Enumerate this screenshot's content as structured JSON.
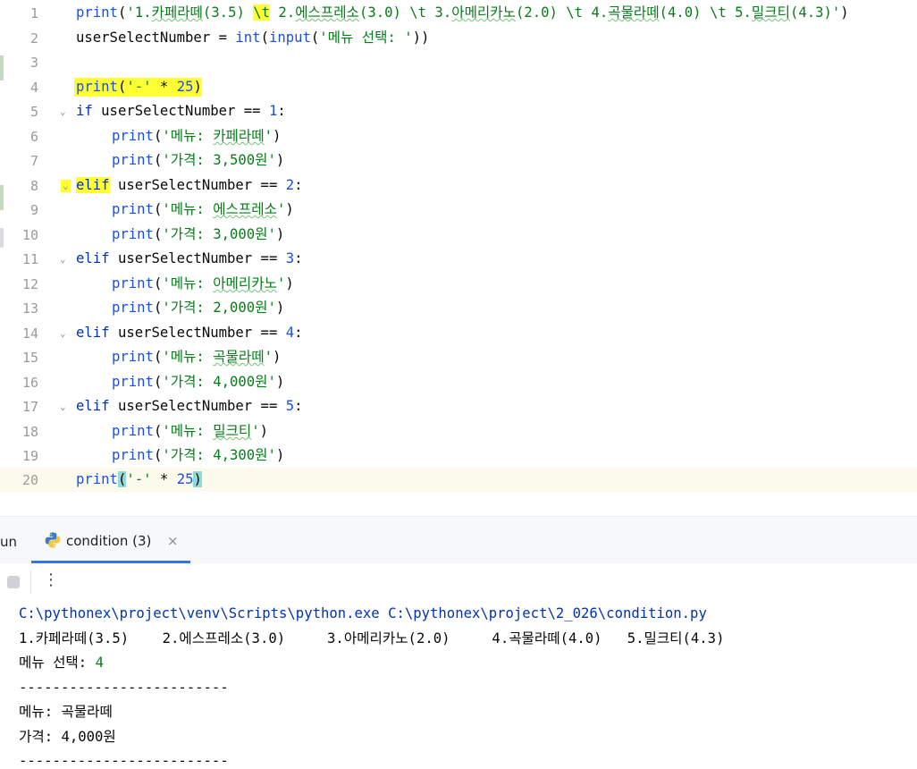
{
  "editor": {
    "line_numbers": [
      "1",
      "2",
      "3",
      "4",
      "5",
      "6",
      "7",
      "8",
      "9",
      "10",
      "11",
      "12",
      "13",
      "14",
      "15",
      "16",
      "17",
      "18",
      "19",
      "20"
    ],
    "lines": {
      "l1": {
        "print": "print",
        "open": "(",
        "s1": "'1.",
        "s2": "카페라떼",
        "s3": "(3.5) ",
        "esc1": "\\t",
        "s4": " 2.",
        "s5": "에스프레소",
        "s6": "(3.0) \\t 3.",
        "s7": "아메리카노",
        "s8": "(2.0) \\t 4.",
        "s9": "곡물라떼",
        "s10": "(4.0) \\t 5.",
        "s11": "밀크티",
        "s12": "(4.3)'",
        "close": ")"
      },
      "l2": {
        "var": "userSelectNumber = ",
        "int": "int",
        "open": "(",
        "input": "input",
        "open2": "(",
        "str": "'메뉴 선택: '",
        "close": "))"
      },
      "l4": {
        "print": "print",
        "open": "(",
        "str": "'-'",
        "rest": " * ",
        "num": "25",
        "close": ")"
      },
      "l5": {
        "kw": "if",
        "rest": " userSelectNumber == ",
        "num": "1",
        "colon": ":"
      },
      "l6": {
        "print": "print",
        "open": "(",
        "s1": "'메뉴: ",
        "s2": "카페라떼",
        "s3": "'",
        "close": ")"
      },
      "l7": {
        "print": "print",
        "open": "(",
        "str": "'가격: 3,500원'",
        "close": ")"
      },
      "l8": {
        "kw": "elif",
        "rest": " userSelectNumber == ",
        "num": "2",
        "colon": ":"
      },
      "l9": {
        "print": "print",
        "open": "(",
        "s1": "'메뉴: ",
        "s2": "에스프레소",
        "s3": "'",
        "close": ")"
      },
      "l10": {
        "print": "print",
        "open": "(",
        "str": "'가격: 3,000원'",
        "close": ")"
      },
      "l11": {
        "kw": "elif",
        "rest": " userSelectNumber == ",
        "num": "3",
        "colon": ":"
      },
      "l12": {
        "print": "print",
        "open": "(",
        "s1": "'메뉴: ",
        "s2": "아메리카노",
        "s3": "'",
        "close": ")"
      },
      "l13": {
        "print": "print",
        "open": "(",
        "str": "'가격: 2,000원'",
        "close": ")"
      },
      "l14": {
        "kw": "elif",
        "rest": " userSelectNumber == ",
        "num": "4",
        "colon": ":"
      },
      "l15": {
        "print": "print",
        "open": "(",
        "s1": "'메뉴: ",
        "s2": "곡물라떼",
        "s3": "'",
        "close": ")"
      },
      "l16": {
        "print": "print",
        "open": "(",
        "str": "'가격: 4,000원'",
        "close": ")"
      },
      "l17": {
        "kw": "elif",
        "rest": " userSelectNumber == ",
        "num": "5",
        "colon": ":"
      },
      "l18": {
        "print": "print",
        "open": "(",
        "s1": "'메뉴: ",
        "s2": "밀크티",
        "s3": "'",
        "close": ")"
      },
      "l19": {
        "print": "print",
        "open": "(",
        "str": "'가격: 4,300원'",
        "close": ")"
      },
      "l20": {
        "print": "print",
        "open": "(",
        "str": "'-'",
        "rest": " * ",
        "num": "25",
        "close": ")"
      }
    },
    "fold_marker": "⌄"
  },
  "run_panel": {
    "label": "un",
    "tab_label": "condition (3)",
    "tab_close": "×",
    "more": "⋮"
  },
  "console": {
    "cmd": "C:\\pythonex\\project\\venv\\Scripts\\python.exe C:\\pythonex\\project\\2_026\\condition.py",
    "menu_line": "1.카페라떼(3.5)    2.에스프레소(3.0)     3.아메리카노(2.0)     4.곡물라떼(4.0)   5.밀크티(4.3)",
    "prompt": "메뉴 선택: ",
    "user_input": "4",
    "sep1": "-------------------------",
    "menu_out": "메뉴: 곡물라떼",
    "price_out": "가격: 4,000원",
    "sep2": "-------------------------"
  }
}
